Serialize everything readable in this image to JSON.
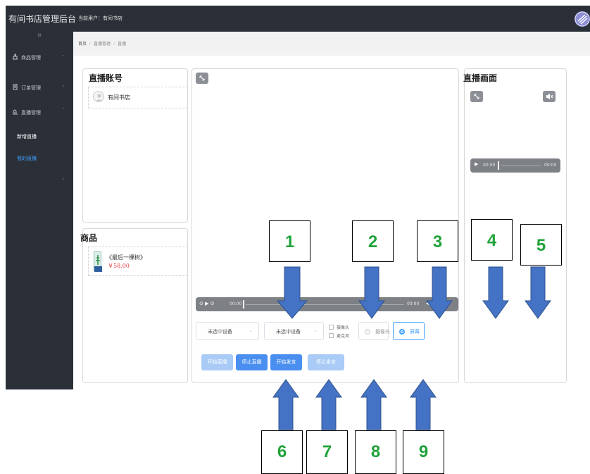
{
  "header": {
    "brand": "有间书店管理后台",
    "current_user": "当前用户：有间书店"
  },
  "sidebar": {
    "toggle": "III",
    "items": [
      {
        "label": "商品管理",
        "arrow": "⌄"
      },
      {
        "label": "订单管理",
        "arrow": "⌄"
      },
      {
        "label": "直播管理",
        "arrow": "⌃"
      }
    ],
    "sub_items": [
      {
        "label": "新增直播",
        "color": "#ffffff"
      },
      {
        "label": "我的直播",
        "color": "#409eff"
      }
    ],
    "extra_arrow": "⌄"
  },
  "breadcrumb": {
    "home": "首页",
    "section": "直播管理",
    "current": "直播"
  },
  "account_panel": {
    "title": "直播账号",
    "account_name": "有间书店"
  },
  "product_panel": {
    "title": "商品",
    "book_title": "《最后一棵树》",
    "book_price": "￥58.00"
  },
  "main_player": {
    "time_start": "00:00",
    "time_end": "00:00"
  },
  "controls": {
    "select_1": "未选中设备",
    "select_2": "未选中设备",
    "checkbox_camera": "摄像头",
    "checkbox_mic": "麦克风",
    "radio_camera": "摄像头",
    "radio_screen": "屏幕"
  },
  "buttons": {
    "start_live": "开始直播",
    "stop_live": "停止直播",
    "start_speak": "开始发言",
    "stop_speak": "停止发言"
  },
  "preview_panel": {
    "title": "直播画面",
    "time_start": "00:00",
    "time_end": "00:00"
  },
  "annotations": {
    "n1": "1",
    "n2": "2",
    "n3": "3",
    "n4": "4",
    "n5": "5",
    "n6": "6",
    "n7": "7",
    "n8": "8",
    "n9": "9",
    "number_color": "#21a33a",
    "arrow_color": "#4472c4"
  }
}
